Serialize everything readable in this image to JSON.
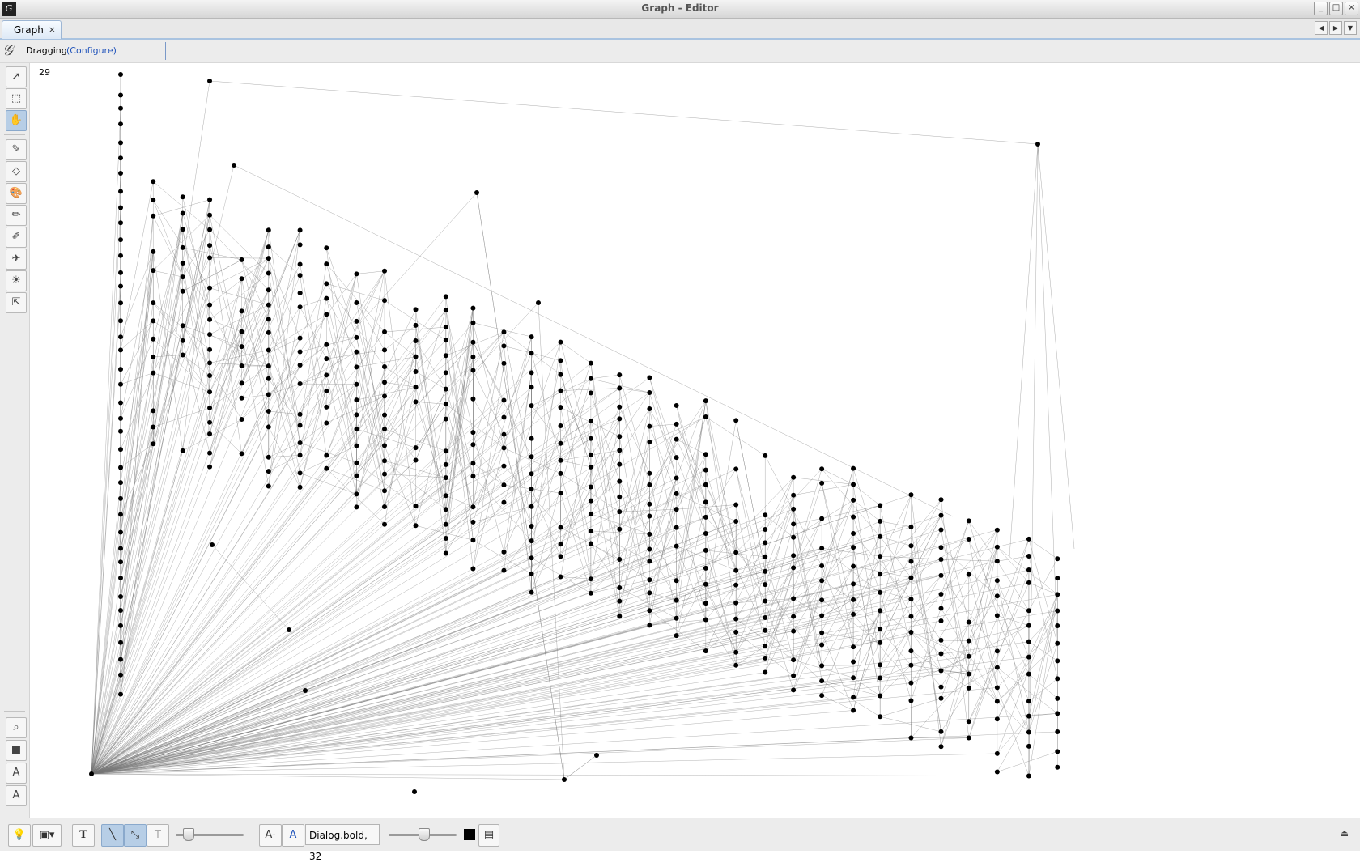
{
  "window": {
    "title": "Graph - Editor",
    "app_icon": "gephi-logo",
    "buttons": [
      "minimize",
      "maximize",
      "close"
    ]
  },
  "tabs": [
    {
      "label": "Graph",
      "close": "×",
      "active": true
    }
  ],
  "tab_nav": [
    "◀",
    "▶",
    "▼"
  ],
  "mode": {
    "label": "Dragging",
    "configure": "(Configure)"
  },
  "canvas": {
    "counter": "29",
    "background": "#ffffff",
    "node_color": "#000000",
    "edge_color": "#888888"
  },
  "left_toolbar": [
    "pointer-icon",
    "rectangle-select-icon",
    "drag-hand-icon",
    "brush-icon",
    "diamond-icon",
    "painter-icon",
    "pencil-icon",
    "edge-pencil-icon",
    "shortest-path-icon",
    "heat-map-icon",
    "edit-node-icon",
    "zoom-icon",
    "node-shape-icon",
    "text-color-icon",
    "label-size-icon"
  ],
  "bottom_toolbar": {
    "font": "Dialog.bold, 32",
    "text_smaller": "A-",
    "text_larger": "A",
    "color": "#000000"
  }
}
